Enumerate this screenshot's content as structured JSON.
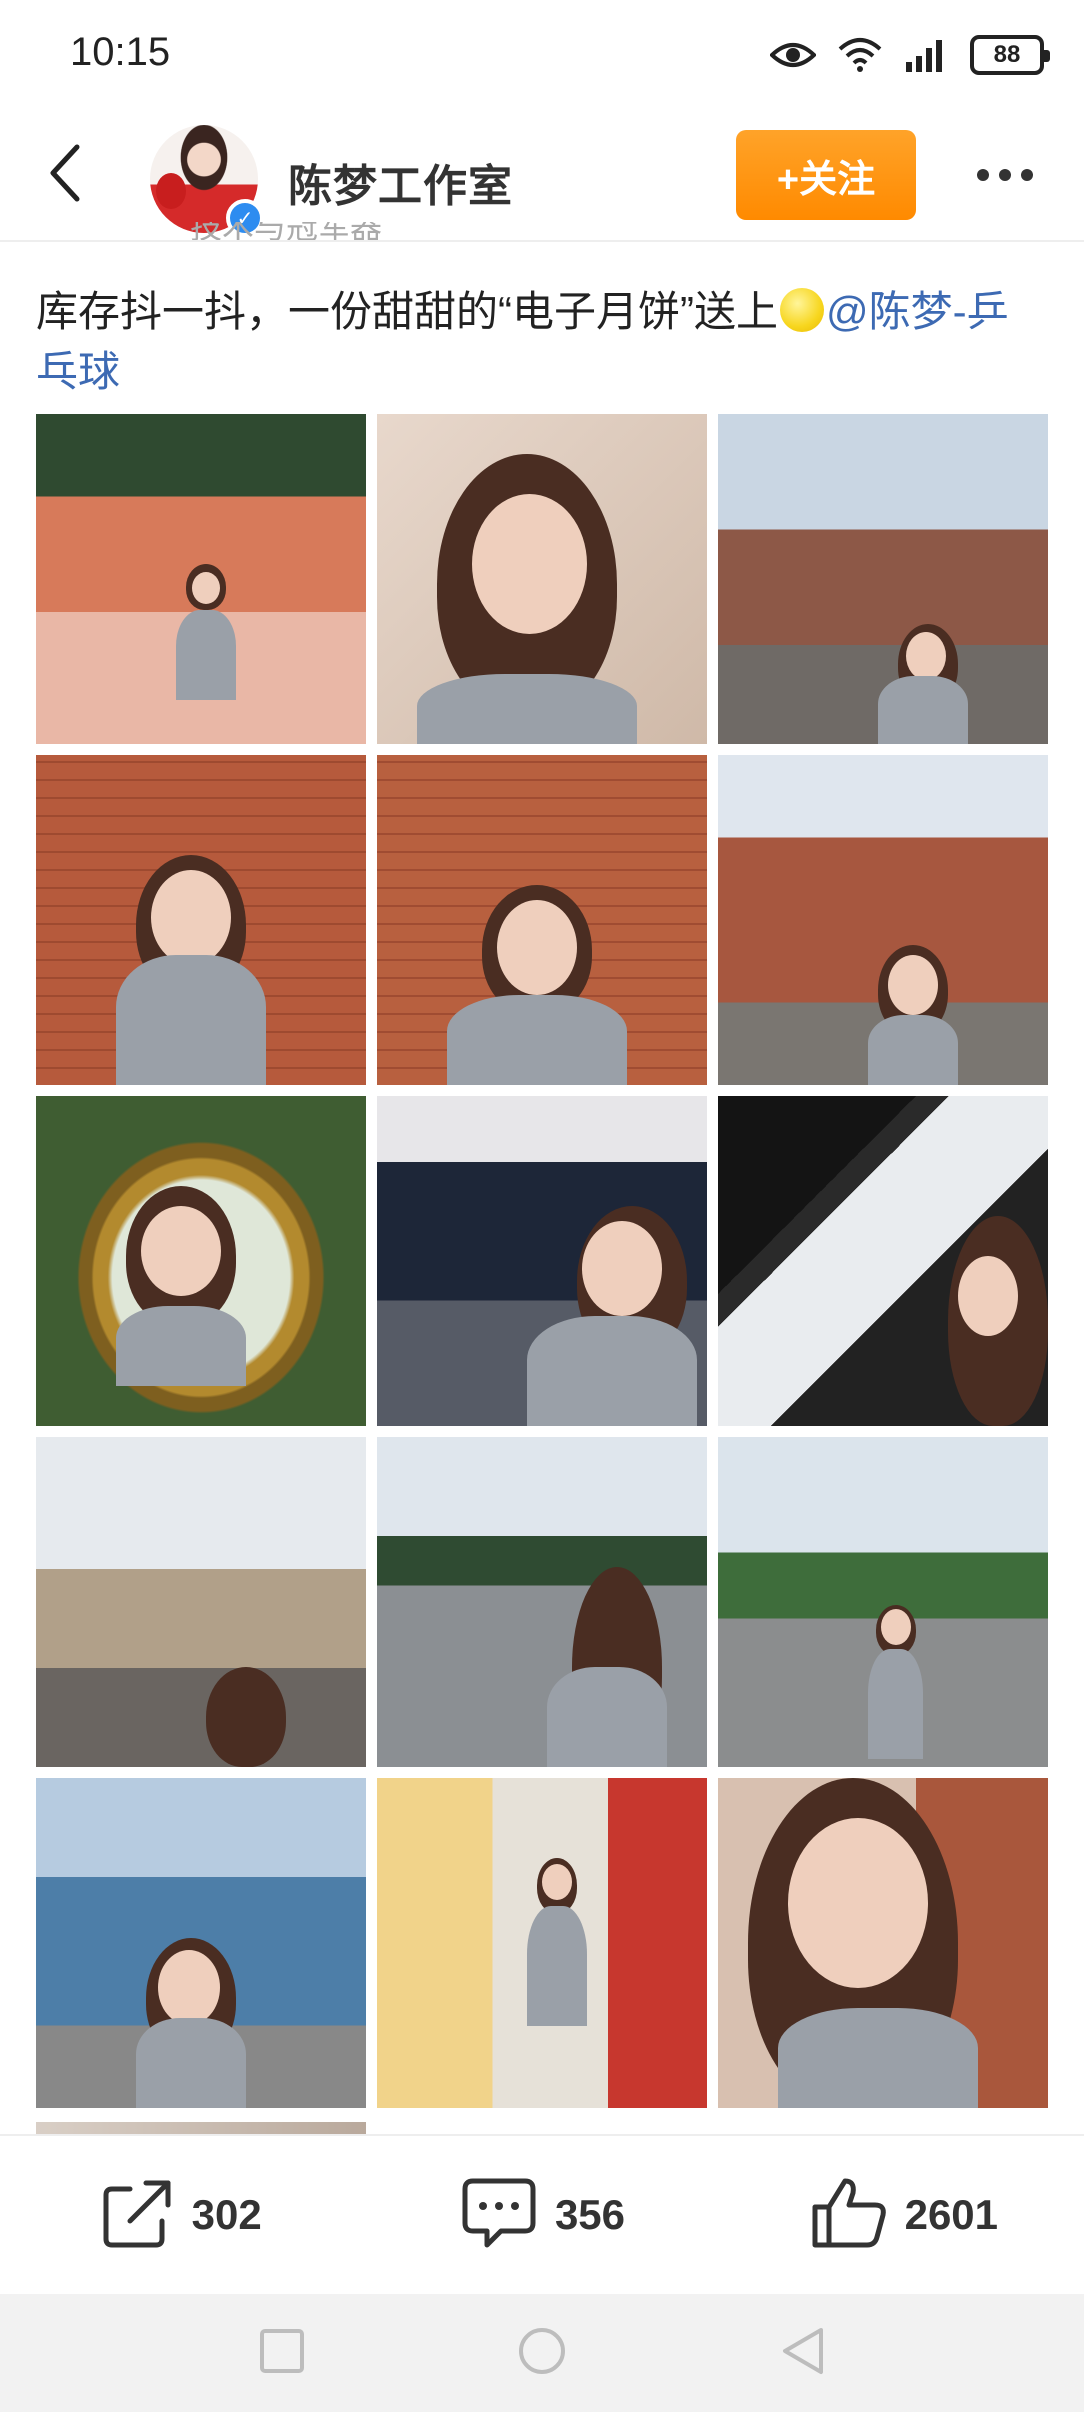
{
  "status_bar": {
    "time": "10:15",
    "battery": "88",
    "icons": [
      "eye-icon",
      "wifi-icon",
      "signal-icon",
      "battery-icon"
    ]
  },
  "header": {
    "name": "陈梦工作室",
    "follow_label": "+关注",
    "peek_text": "技术与冠军器",
    "verified_color": "#2d8cf0",
    "follow_color": "#ff9a1a"
  },
  "post": {
    "text": "库存抖一抖，一份甜甜的“电子月饼”送上",
    "emoji": "full-moon-face-emoji",
    "mention": "@陈梦-乒乓球",
    "mention_color": "#3d6ab3"
  },
  "photos": [
    "photo-1",
    "photo-2",
    "photo-3",
    "photo-4",
    "photo-5",
    "photo-6",
    "photo-7",
    "photo-8",
    "photo-9",
    "photo-10",
    "photo-11",
    "photo-12",
    "photo-13",
    "photo-14",
    "photo-15"
  ],
  "actions": {
    "share_count": "302",
    "comment_count": "356",
    "like_count": "2601"
  },
  "nav": {
    "icons": [
      "recents-square-icon",
      "home-circle-icon",
      "back-triangle-icon"
    ]
  }
}
